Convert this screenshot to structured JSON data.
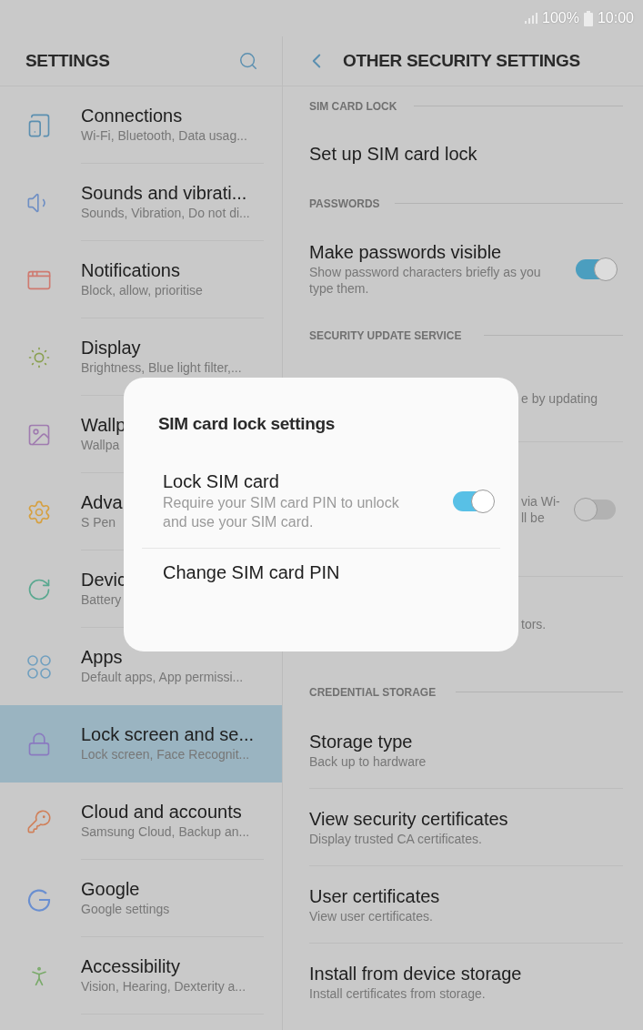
{
  "status_bar": {
    "battery": "100%",
    "time": "10:00"
  },
  "sidebar": {
    "title": "SETTINGS",
    "items": [
      {
        "kind": "connections",
        "title": "Connections",
        "subtitle": "Wi-Fi, Bluetooth, Data usag...",
        "color": "#5b8fb0",
        "selected": false
      },
      {
        "kind": "sounds",
        "title": "Sounds and vibrati...",
        "subtitle": "Sounds, Vibration, Do not di...",
        "color": "#6f8fc4",
        "selected": false
      },
      {
        "kind": "notifications",
        "title": "Notifications",
        "subtitle": "Block, allow, prioritise",
        "color": "#cf7a70",
        "selected": false
      },
      {
        "kind": "display",
        "title": "Display",
        "subtitle": "Brightness, Blue light filter,...",
        "color": "#8aa050",
        "selected": false
      },
      {
        "kind": "wallpaper",
        "title": "Wallp",
        "subtitle": "Wallpa",
        "color": "#a07cb0",
        "selected": false
      },
      {
        "kind": "advanced",
        "title": "Adva",
        "subtitle": "S Pen",
        "color": "#d6a040",
        "selected": false
      },
      {
        "kind": "device",
        "title": "Devic",
        "subtitle": "Battery",
        "color": "#5aa890",
        "selected": false
      },
      {
        "kind": "apps",
        "title": "Apps",
        "subtitle": "Default apps, App permissi...",
        "color": "#6f9fbf",
        "selected": false
      },
      {
        "kind": "lock",
        "title": "Lock screen and se...",
        "subtitle": "Lock screen, Face Recognit...",
        "color": "#8a7ac0",
        "selected": true
      },
      {
        "kind": "cloud",
        "title": "Cloud and accounts",
        "subtitle": "Samsung Cloud, Backup an...",
        "color": "#d0805a",
        "selected": false
      },
      {
        "kind": "google",
        "title": "Google",
        "subtitle": "Google settings",
        "color": "#6a8fd0",
        "selected": false
      },
      {
        "kind": "accessibility",
        "title": "Accessibility",
        "subtitle": "Vision, Hearing, Dexterity a...",
        "color": "#7aaa6a",
        "selected": false
      }
    ]
  },
  "detail": {
    "title": "OTHER SECURITY SETTINGS",
    "sections": [
      {
        "header": "SIM CARD LOCK",
        "rows": [
          {
            "kind": "plain",
            "title": "Set up SIM card lock"
          }
        ]
      },
      {
        "header": "PASSWORDS",
        "rows": [
          {
            "kind": "toggle",
            "title": "Make passwords visible",
            "subtitle": "Show password characters briefly as you type them.",
            "on": true
          }
        ]
      },
      {
        "header": "SECURITY UPDATE SERVICE",
        "rows": [
          {
            "kind": "covered",
            "fragments": [
              "e by updating"
            ]
          },
          {
            "kind": "covered-toggle",
            "fragments": [
              "via Wi-",
              "ll be"
            ],
            "on": false
          },
          {
            "kind": "covered",
            "fragments": [
              "tors."
            ]
          }
        ]
      },
      {
        "header": "CREDENTIAL STORAGE",
        "rows": [
          {
            "kind": "plain",
            "title": "Storage type",
            "subtitle": "Back up to hardware"
          },
          {
            "kind": "plain",
            "title": "View security certificates",
            "subtitle": "Display trusted CA certificates."
          },
          {
            "kind": "plain",
            "title": "User certificates",
            "subtitle": "View user certificates."
          },
          {
            "kind": "plain",
            "title": "Install from device storage",
            "subtitle": "Install certificates from storage."
          }
        ]
      }
    ]
  },
  "dialog": {
    "title": "SIM card lock settings",
    "items": [
      {
        "kind": "toggle",
        "title": "Lock SIM card",
        "subtitle": "Require your SIM card PIN to unlock and use your SIM card.",
        "on": true
      },
      {
        "kind": "plain",
        "title": "Change SIM card PIN"
      }
    ]
  }
}
